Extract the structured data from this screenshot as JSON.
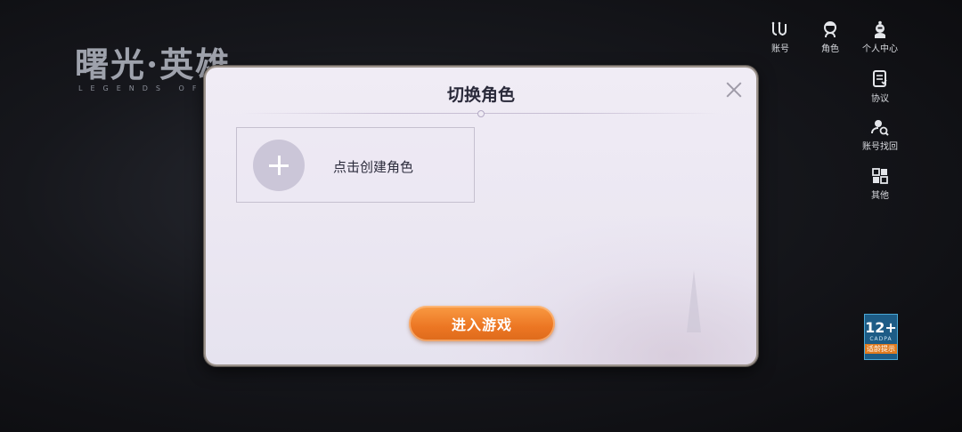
{
  "background": {
    "logo_title": "曙光·英雄",
    "logo_subtitle": "LEGENDS OF"
  },
  "side_menu": {
    "items": [
      {
        "label": "账号",
        "icon": "account-icon"
      },
      {
        "label": "角色",
        "icon": "character-icon"
      },
      {
        "label": "个人中心",
        "icon": "user-center-icon"
      },
      {
        "label": "协议",
        "icon": "agreement-icon"
      },
      {
        "label": "账号找回",
        "icon": "account-recovery-icon"
      },
      {
        "label": "其他",
        "icon": "more-icon"
      }
    ]
  },
  "age_rating": {
    "value": "12+",
    "tag": "CADPA",
    "label": "适龄提示"
  },
  "dialog": {
    "title": "切换角色",
    "create_label": "点击创建角色",
    "enter_button": "进入游戏"
  },
  "colors": {
    "accent": "#ec7623",
    "dialog_bg": "#ebe7f2",
    "background": "#16171c"
  }
}
